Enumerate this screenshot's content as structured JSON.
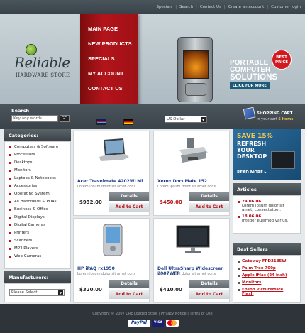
{
  "top_links": [
    "Specials",
    "Search",
    "Contact Us",
    "Create an account",
    "Customer login"
  ],
  "logo": {
    "title": "Reliable",
    "subtitle": "HARDWARE STORE"
  },
  "main_menu": [
    "MAIN PAGE",
    "NEW PRODUCTS",
    "SPECIALS",
    "MY ACCOUNT",
    "CONTACT US"
  ],
  "promo": {
    "line1": "PORTABLE",
    "line2": "COMPUTER",
    "line3": "SOLUTIONS",
    "click": "CLICK FOR MORE",
    "badge": "BEST PRICE"
  },
  "search": {
    "label": "Search",
    "value": "Key any words",
    "go": "GO"
  },
  "currency": {
    "selected": "US Dollar"
  },
  "cart": {
    "title": "SHOPPING CART",
    "items_text": "in your cart",
    "items_count": "5 items"
  },
  "categories": {
    "title": "Categories:",
    "items": [
      "Computers & Software",
      "Processors",
      "Desktops",
      "Monitors",
      "Laptops & Notebooks",
      "Accessories",
      "Operating System",
      "All Handhelds & PDAs",
      "Business & Office",
      "Digital Displays",
      "Digital Cameras",
      "Printers",
      "Scanners",
      "MP3 Players",
      "Web Cameras"
    ]
  },
  "manufacturers": {
    "title": "Manufacturers:",
    "selected": "Please Select"
  },
  "products": [
    {
      "name": "Acer Travelmate 4202WLMi",
      "desc": "Lorem ipsum dolor sit amet cons",
      "price": "$932.00",
      "details": "Details",
      "add": "Add to Cart"
    },
    {
      "name": "Xerox DocuMate 152",
      "desc": "Lorem ipsum dolor sit amet cons",
      "price": "$450.00",
      "details": "Details",
      "add": "Add to Cart"
    },
    {
      "name": "HP iPAQ rx1950",
      "desc": "Lorem ipsum dolor sit amet cons",
      "price": "$320.00",
      "details": "Details",
      "add": "Add to Cart"
    },
    {
      "name": "Dell UltraSharp Widescreen 2007WFP",
      "desc": "Lorem ipsum dolor sit amet cons",
      "price": "$410.00",
      "details": "Details",
      "add": "Add to Cart"
    }
  ],
  "ad": {
    "line1": "SAVE 15%",
    "line2": "REFRESH",
    "line3": "YOUR",
    "line4": "DESKTOP",
    "more": "READ MORE ▸"
  },
  "articles": {
    "title": "Articles",
    "items": [
      {
        "date": "24.06.06",
        "text": "Lorem ipsum dolor sit amet, consectetuer."
      },
      {
        "date": "18.06.06",
        "text": "Integer euismod varius."
      }
    ]
  },
  "best_sellers": {
    "title": "Best Sellers",
    "items": [
      "Gateway FPD2185W",
      "Palm Treo 700p",
      "Apple iMac (24 inch)",
      "Monitors",
      "Epson PictureMate Flash"
    ]
  },
  "footer": {
    "copyright": "Copyright © 2007 CRE Loaded Store",
    "privacy": "Privacy Notice",
    "terms": "Terms of Use",
    "paypal": "PayPal",
    "visa": "VISA"
  },
  "colors": {
    "accent": "#b8141a",
    "link": "#1f3d8a",
    "dark": "#2e3439"
  }
}
